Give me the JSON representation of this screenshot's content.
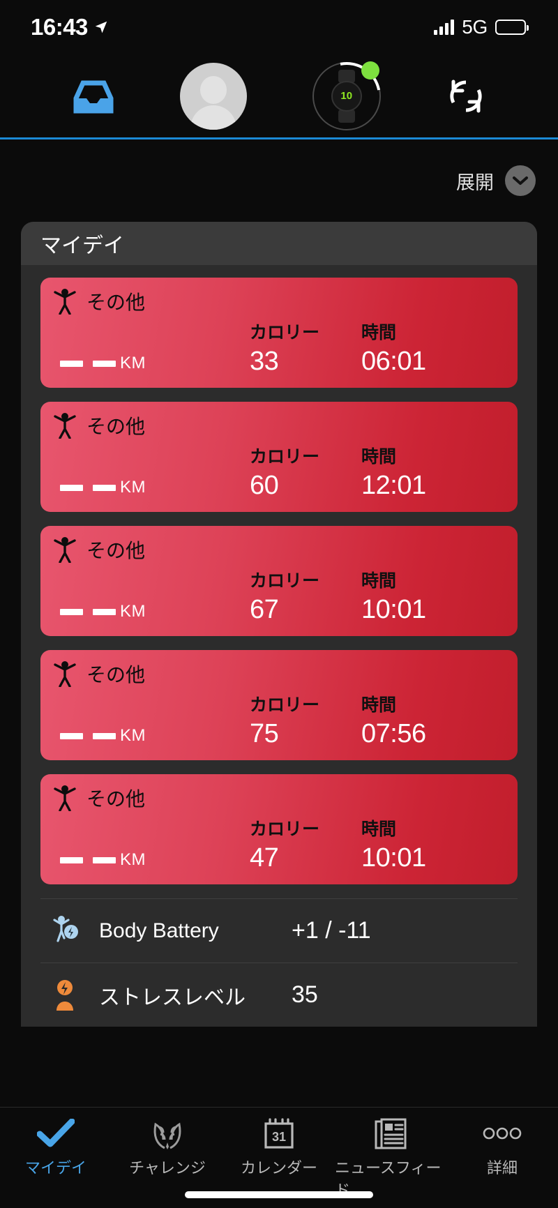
{
  "status_bar": {
    "time": "16:43",
    "network": "5G",
    "location_icon": "location-arrow-icon",
    "signal_icon": "cellular-signal-icon",
    "battery_icon": "battery-full-icon"
  },
  "header": {
    "inbox_icon": "inbox-tray-icon",
    "avatar_icon": "user-avatar-icon",
    "device_icon": "garmin-watch-icon",
    "device_watch_number": "10",
    "sync_icon": "sync-refresh-icon",
    "accent_color": "#1b8ad6"
  },
  "expand": {
    "label": "展開",
    "chevron_icon": "chevron-down-icon"
  },
  "panel": {
    "title": "マイデイ"
  },
  "activities": [
    {
      "icon": "activity-person-icon",
      "name": "その他",
      "distance": "--",
      "unit": "KM",
      "calories_label": "カロリー",
      "calories": "33",
      "time_label": "時間",
      "time": "06:01"
    },
    {
      "icon": "activity-person-icon",
      "name": "その他",
      "distance": "--",
      "unit": "KM",
      "calories_label": "カロリー",
      "calories": "60",
      "time_label": "時間",
      "time": "12:01"
    },
    {
      "icon": "activity-person-icon",
      "name": "その他",
      "distance": "--",
      "unit": "KM",
      "calories_label": "カロリー",
      "calories": "67",
      "time_label": "時間",
      "time": "10:01"
    },
    {
      "icon": "activity-person-icon",
      "name": "その他",
      "distance": "--",
      "unit": "KM",
      "calories_label": "カロリー",
      "calories": "75",
      "time_label": "時間",
      "time": "07:56"
    },
    {
      "icon": "activity-person-icon",
      "name": "その他",
      "distance": "--",
      "unit": "KM",
      "calories_label": "カロリー",
      "calories": "47",
      "time_label": "時間",
      "time": "10:01"
    }
  ],
  "metrics": [
    {
      "icon": "body-battery-icon",
      "label": "Body Battery",
      "value": "+1 / -11",
      "color": "#aed4ef"
    },
    {
      "icon": "stress-level-icon",
      "label": "ストレスレベル",
      "value": "35",
      "color": "#ee8a3b"
    }
  ],
  "tabs": [
    {
      "label": "マイデイ",
      "icon": "checkmark-icon",
      "active": true
    },
    {
      "label": "チャレンジ",
      "icon": "laurel-wreath-icon",
      "active": false
    },
    {
      "label": "カレンダー",
      "icon": "calendar-icon",
      "active": false
    },
    {
      "label": "ニュースフィード",
      "icon": "newspaper-icon",
      "active": false
    },
    {
      "label": "詳細",
      "icon": "more-dots-icon",
      "active": false
    }
  ],
  "colors": {
    "card_gradient_start": "#e8566e",
    "card_gradient_end": "#c11e2c",
    "active_tab": "#49a5e8",
    "panel_bg": "#2c2c2c"
  }
}
